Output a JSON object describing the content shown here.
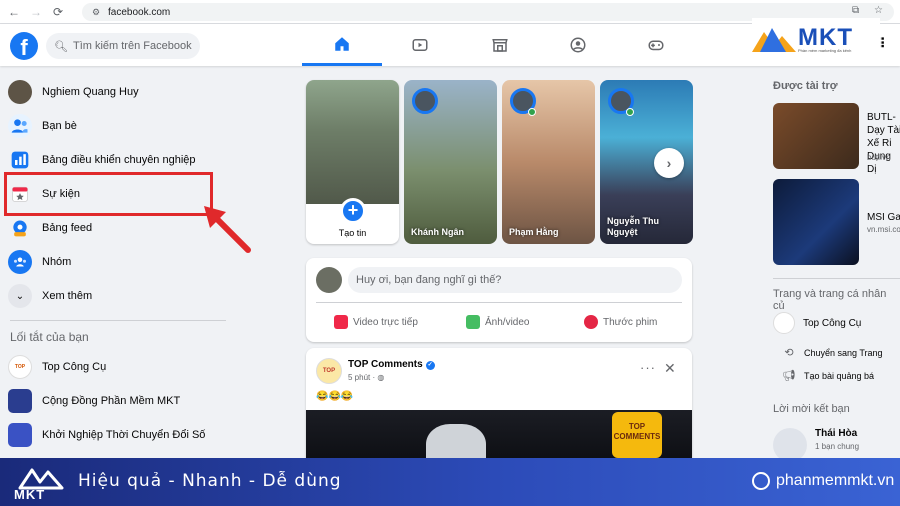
{
  "browser": {
    "url": "facebook.com"
  },
  "fb": {
    "search_placeholder": "Tìm kiếm trên Facebook"
  },
  "mkt_logo": {
    "text": "MKT",
    "subtext": "Phần mềm marketing đa kênh"
  },
  "left_menu": [
    {
      "label": "Nghiem Quang Huy",
      "icon": "profile-avatar"
    },
    {
      "label": "Bạn bè",
      "icon": "friends-icon"
    },
    {
      "label": "Bảng điều khiển chuyên nghiệp",
      "icon": "dashboard-icon"
    },
    {
      "label": "Sự kiện",
      "icon": "calendar-icon"
    },
    {
      "label": "Bảng feed",
      "icon": "feed-icon"
    },
    {
      "label": "Nhóm",
      "icon": "groups-icon"
    },
    {
      "label": "Xem thêm",
      "icon": "chevron-down-icon"
    }
  ],
  "shortcuts": {
    "title": "Lối tắt của bạn",
    "items": [
      {
        "label": "Top Công Cụ"
      },
      {
        "label": "Cộng Đồng Phần Mềm MKT"
      },
      {
        "label": "Khởi Nghiệp Thời Chuyển Đổi Số"
      }
    ]
  },
  "stories": {
    "create_label": "Tạo tin",
    "items": [
      {
        "name": "Khánh Ngân"
      },
      {
        "name": "Phạm Hằng"
      },
      {
        "name": "Nguyễn Thu Nguyệt"
      }
    ]
  },
  "composer": {
    "placeholder": "Huy ơi, bạn đang nghĩ gì thế?",
    "actions": [
      {
        "label": "Video trực tiếp",
        "color": "#f02849"
      },
      {
        "label": "Ảnh/video",
        "color": "#45bd62"
      },
      {
        "label": "Thước phim",
        "color": "#e42645"
      }
    ]
  },
  "post": {
    "author": "TOP Comments",
    "time": "5 phút ·",
    "text": "😂😂😂",
    "badge": "TOP COMMENTS"
  },
  "right": {
    "sponsored_title": "Được tài trợ",
    "ads": [
      {
        "title": "BUTL- Dạy Tài Xế Ri Dụng Dị",
        "domain": "butl.vn"
      },
      {
        "title": "MSI Ga",
        "domain": "vn.msi.com"
      }
    ],
    "pages_title": "Trang và trang cá nhân củ",
    "page_name": "Top Công Cụ",
    "page_actions": [
      {
        "label": "Chuyển sang Trang"
      },
      {
        "label": "Tạo bài quảng bá"
      }
    ],
    "invites_title": "Lời mời kết bạn",
    "invite": {
      "name": "Thái Hòa",
      "mutual": "1 bạn chung"
    }
  },
  "banner": {
    "logo_text": "MKT",
    "slogan": "Hiệu quả - Nhanh  - Dễ dùng",
    "site": "phanmemmkt.vn"
  },
  "colors": {
    "facebook_blue": "#1877f2",
    "highlight_red": "#e0292b",
    "banner_blue": "#2c4bb8"
  }
}
